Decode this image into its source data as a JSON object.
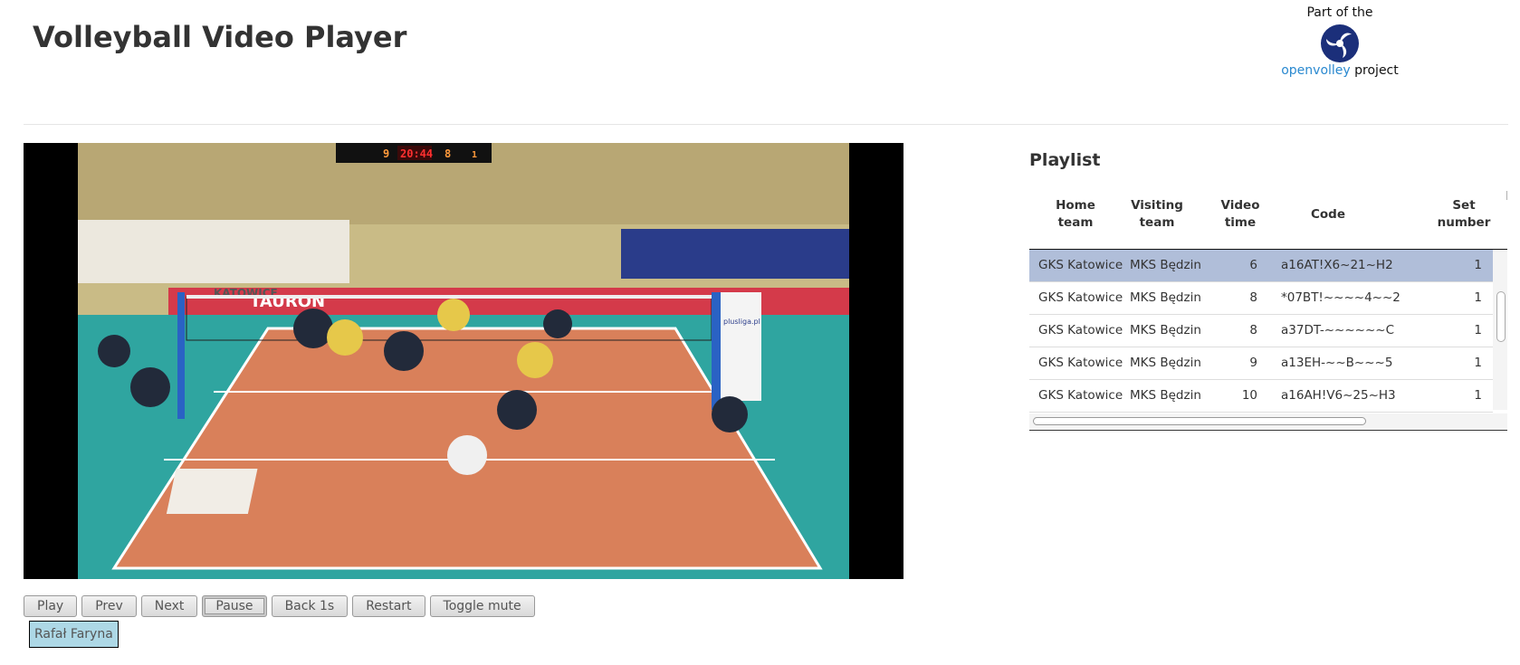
{
  "app": {
    "title": "Volleyball Video Player"
  },
  "credit": {
    "prefix": "Part of the",
    "link_text": "openvolley",
    "suffix": "project"
  },
  "video": {
    "scoreboard": {
      "home_score": "9",
      "clock": "20:44",
      "away_score": "8",
      "set": "1"
    },
    "banners": {
      "main": "TAURON",
      "side": "plusliga.pl",
      "left": "KATOWICE"
    }
  },
  "controls": {
    "play": "Play",
    "prev": "Prev",
    "next": "Next",
    "pause": "Pause",
    "back": "Back 1s",
    "restart": "Restart",
    "mute": "Toggle mute"
  },
  "player_badge": "Rafał Faryna",
  "playlist": {
    "title": "Playlist",
    "columns": {
      "home_team": "Home team",
      "visiting_team": "Visiting team",
      "video_time": "Video time",
      "code": "Code",
      "set_number": "Set number",
      "next_col": "H"
    },
    "rows": [
      {
        "home": "GKS Katowice",
        "visiting": "MKS Będzin",
        "time": "6",
        "code": "a16AT!X6~21~H2",
        "set": "1",
        "selected": true
      },
      {
        "home": "GKS Katowice",
        "visiting": "MKS Będzin",
        "time": "8",
        "code": "*07BT!~~~~4~~2",
        "set": "1",
        "selected": false
      },
      {
        "home": "GKS Katowice",
        "visiting": "MKS Będzin",
        "time": "8",
        "code": "a37DT-~~~~~~C",
        "set": "1",
        "selected": false
      },
      {
        "home": "GKS Katowice",
        "visiting": "MKS Będzin",
        "time": "9",
        "code": "a13EH-~~B~~~5",
        "set": "1",
        "selected": false
      },
      {
        "home": "GKS Katowice",
        "visiting": "MKS Będzin",
        "time": "10",
        "code": "a16AH!V6~25~H3",
        "set": "1",
        "selected": false
      }
    ]
  },
  "colors": {
    "selected_row": "#b0bed9",
    "link": "#2a89d0",
    "badge": "#add8e6",
    "court": "#d9805a",
    "floor": "#2fa5a0"
  }
}
